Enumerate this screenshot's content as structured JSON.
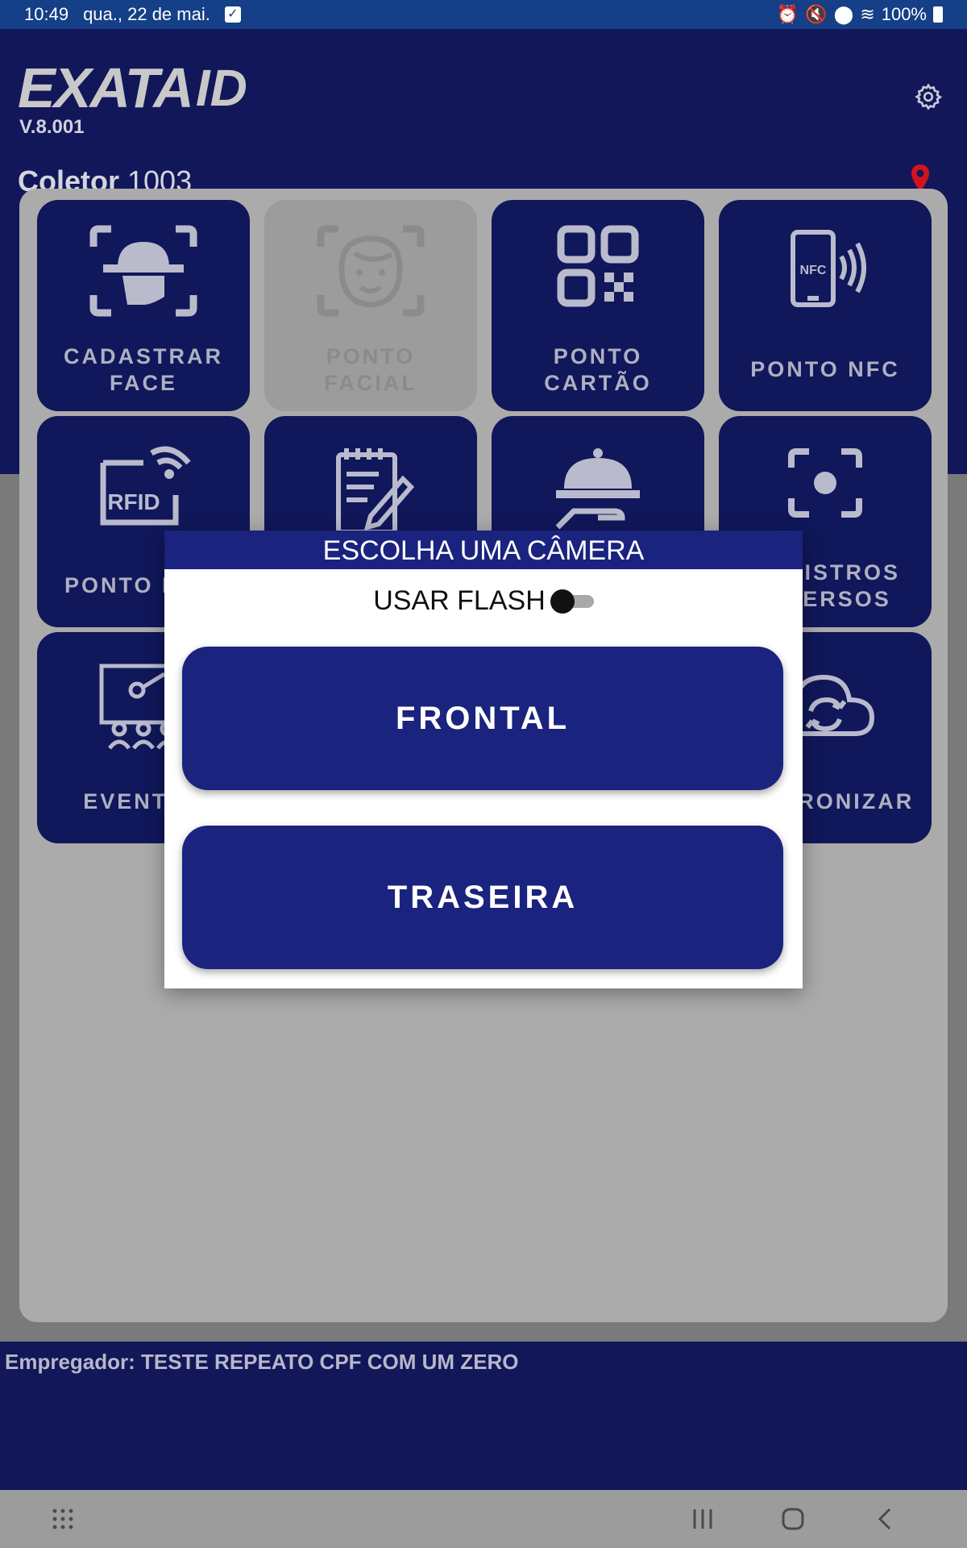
{
  "status_bar": {
    "time": "10:49",
    "date": "qua., 22 de mai.",
    "battery": "100%"
  },
  "header": {
    "logo_text": "EXATA",
    "logo_suffix": "ID",
    "version": "V.8.001",
    "coletor_label": "Coletor",
    "coletor_value": "1003"
  },
  "tiles": [
    {
      "label": "CADASTRAR\nFACE",
      "icon": "face-scan-icon",
      "enabled": true
    },
    {
      "label": "PONTO\nFACIAL",
      "icon": "face-recognition-icon",
      "enabled": false
    },
    {
      "label": "PONTO\nCARTÃO",
      "icon": "qr-code-icon",
      "enabled": true
    },
    {
      "label": "PONTO NFC",
      "icon": "nfc-phone-icon",
      "enabled": true
    },
    {
      "label": "PONTO RFID",
      "icon": "rfid-icon",
      "enabled": true
    },
    {
      "label": "",
      "icon": "notepad-pen-icon",
      "enabled": true
    },
    {
      "label": "",
      "icon": "cloche-hand-icon",
      "enabled": true
    },
    {
      "label": "REGISTROS\nDIVERSOS",
      "icon": "focus-icon",
      "enabled": true
    },
    {
      "label": "EVENTOS",
      "icon": "presentation-icon",
      "enabled": true
    },
    {
      "label": "SINCRONIZAR",
      "icon": "cloud-sync-icon",
      "enabled": true
    }
  ],
  "footer": {
    "empregador": "Empregador: TESTE REPEATO CPF COM UM ZERO"
  },
  "dialog": {
    "title": "ESCOLHA UMA CÂMERA",
    "flash_label": "USAR FLASH",
    "flash_on": false,
    "front_label": "FRONTAL",
    "back_label": "TRASEIRA"
  },
  "colors": {
    "primary": "#1a237e",
    "header": "#12175a",
    "statusbar": "#153f86",
    "pin": "#d0141e"
  }
}
